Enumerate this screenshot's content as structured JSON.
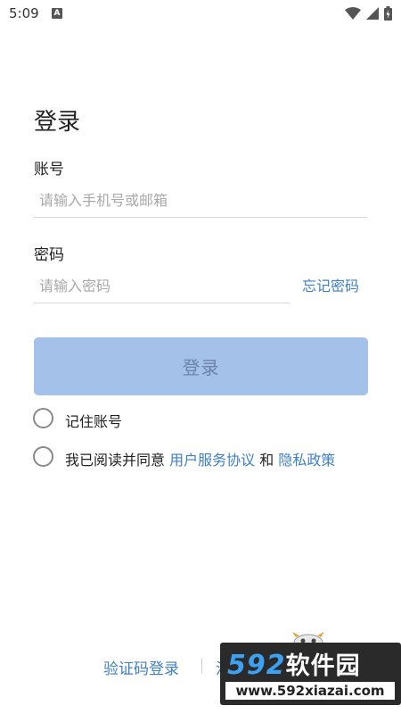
{
  "status_bar": {
    "time": "5:09",
    "notification_letter": "A"
  },
  "login": {
    "title": "登录",
    "account_label": "账号",
    "account_placeholder": "请输入手机号或邮箱",
    "password_label": "密码",
    "password_placeholder": "请输入密码",
    "forgot_password": "忘记密码",
    "login_button": "登录",
    "remember_account": "记住账号",
    "agreement_prefix": "我已阅读并同意 ",
    "user_agreement": "用户服务协议",
    "agreement_and": " 和 ",
    "privacy_policy": "隐私政策"
  },
  "bottom": {
    "sms_login": "验证码登录",
    "register_partial": "注"
  },
  "watermark": {
    "logo_number": "592",
    "logo_text": "软件园",
    "url": "www.592xiazai.com"
  },
  "colors": {
    "accent": "#3f80c4",
    "button_bg": "#a4c1e9",
    "button_text": "#6b83a8"
  }
}
